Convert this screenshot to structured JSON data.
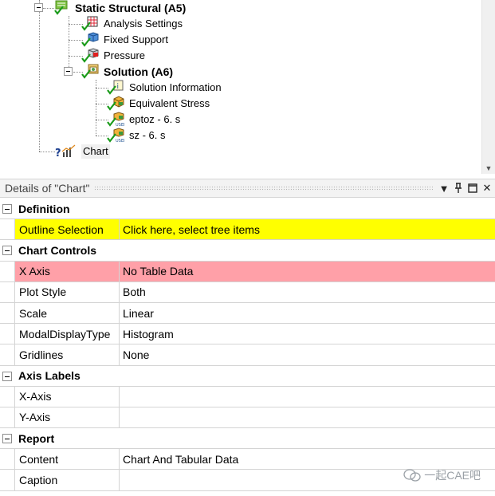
{
  "tree": {
    "items": [
      {
        "label": "Static Structural (A5)",
        "bold": true
      },
      {
        "label": "Analysis Settings"
      },
      {
        "label": "Fixed Support"
      },
      {
        "label": "Pressure"
      },
      {
        "label": "Solution (A6)",
        "bold": true
      },
      {
        "label": "Solution Information"
      },
      {
        "label": "Equivalent Stress"
      },
      {
        "label": "eptoz - 6. s"
      },
      {
        "label": "sz - 6. s"
      },
      {
        "label": "Chart"
      }
    ]
  },
  "details": {
    "title": "Details of \"Chart\"",
    "controls": {
      "dropdown": "▾",
      "pin": "📌",
      "restore": "☐",
      "close": "✕"
    },
    "sections": [
      {
        "label": "Definition",
        "rows": [
          {
            "name": "Outline Selection",
            "value": "Click here, select tree items",
            "highlight": "yellow"
          }
        ]
      },
      {
        "label": "Chart Controls",
        "rows": [
          {
            "name": "X Axis",
            "value": "No Table Data",
            "highlight": "pink"
          },
          {
            "name": "Plot Style",
            "value": "Both"
          },
          {
            "name": "Scale",
            "value": "Linear"
          },
          {
            "name": "ModalDisplayType",
            "value": "Histogram"
          },
          {
            "name": "Gridlines",
            "value": "None"
          }
        ]
      },
      {
        "label": "Axis Labels",
        "rows": [
          {
            "name": "X-Axis",
            "value": ""
          },
          {
            "name": "Y-Axis",
            "value": ""
          }
        ]
      },
      {
        "label": "Report",
        "rows": [
          {
            "name": "Content",
            "value": "Chart And Tabular Data"
          },
          {
            "name": "Caption",
            "value": ""
          }
        ]
      }
    ]
  },
  "watermark": {
    "text": "一起CAE吧"
  },
  "colors": {
    "highlight_yellow": "#ffff00",
    "highlight_pink": "#ffa0a8",
    "check_green": "#1a9b1a"
  }
}
